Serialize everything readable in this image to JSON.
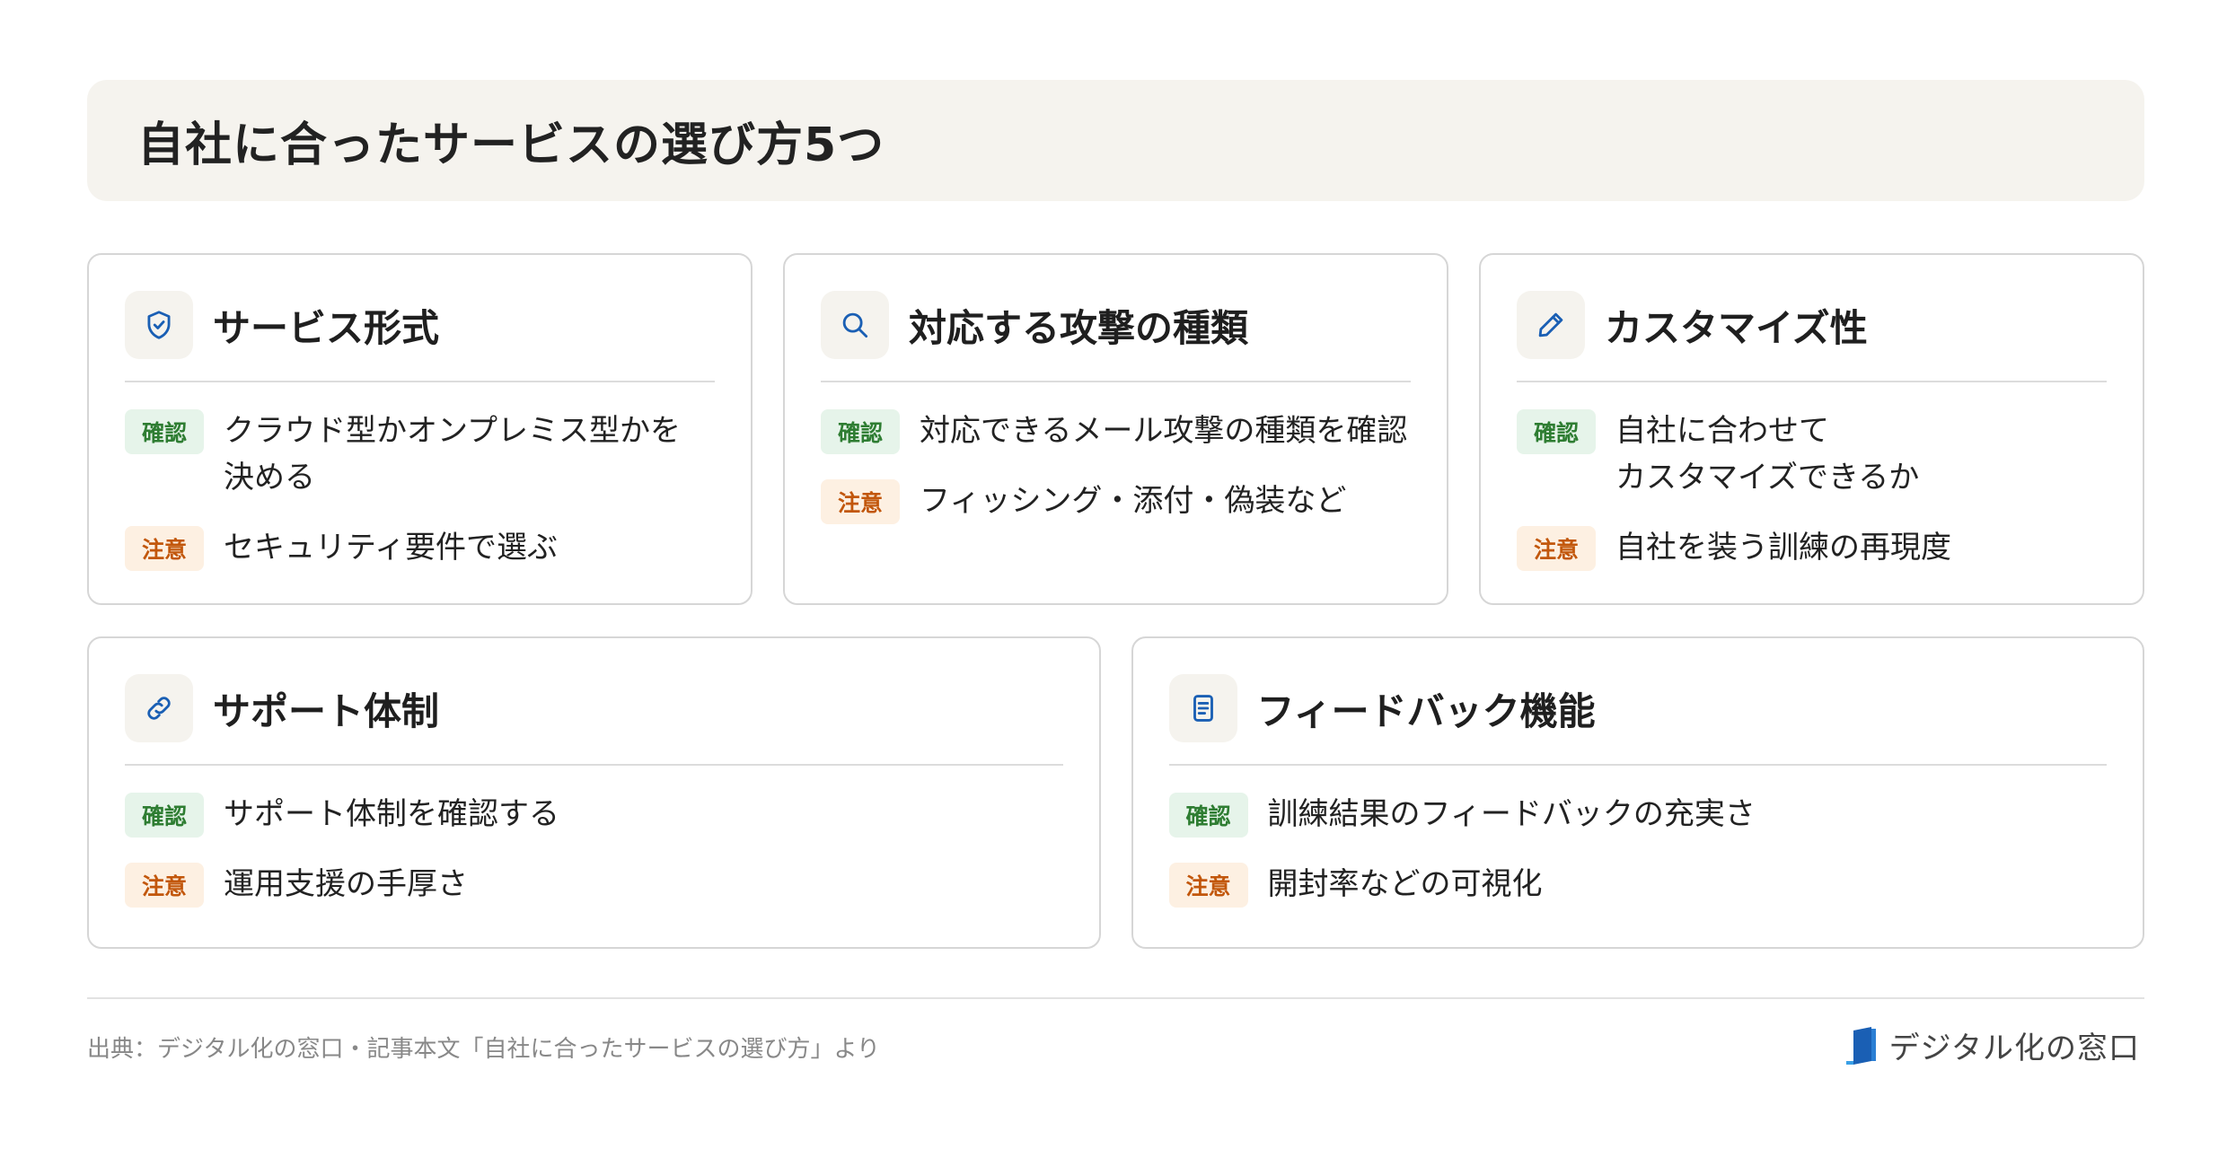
{
  "title": "自社に合ったサービスの選び方5つ",
  "cards": [
    {
      "title": "サービス形式",
      "icon": "shield-check-icon",
      "items": [
        {
          "badge": "確認",
          "text": "クラウド型かオンプレミス型かを決める"
        },
        {
          "badge": "注意",
          "text": "セキュリティ要件で選ぶ"
        }
      ]
    },
    {
      "title": "対応する攻撃の種類",
      "icon": "search-icon",
      "items": [
        {
          "badge": "確認",
          "text": "対応できるメール攻撃の種類を確認"
        },
        {
          "badge": "注意",
          "text": "フィッシング・添付・偽装など"
        }
      ]
    },
    {
      "title": "カスタマイズ性",
      "icon": "pencil-icon",
      "items": [
        {
          "badge": "確認",
          "text": "自社に合わせて\nカスタマイズできるか"
        },
        {
          "badge": "注意",
          "text": "自社を装う訓練の再現度"
        }
      ]
    },
    {
      "title": "サポート体制",
      "icon": "link-icon",
      "items": [
        {
          "badge": "確認",
          "text": "サポート体制を確認する"
        },
        {
          "badge": "注意",
          "text": "運用支援の手厚さ"
        }
      ]
    },
    {
      "title": "フィードバック機能",
      "icon": "document-icon",
      "items": [
        {
          "badge": "確認",
          "text": "訓練結果のフィードバックの充実さ"
        },
        {
          "badge": "注意",
          "text": "開封率などの可視化"
        }
      ]
    }
  ],
  "source": "出典：デジタル化の窓口・記事本文「自社に合ったサービスの選び方」より",
  "brand": "デジタル化の窓口",
  "colors": {
    "accent": "#1a5fb4",
    "confirm_bg": "#e6f4ea",
    "confirm_text": "#2e7d32",
    "caution_bg": "#fdf0e2",
    "caution_text": "#c2570c",
    "title_bg": "#f5f3ee"
  }
}
